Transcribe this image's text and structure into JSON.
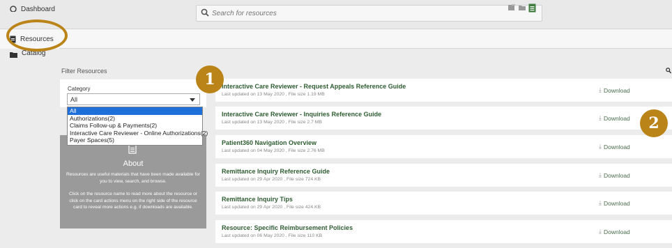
{
  "search": {
    "placeholder": "Search for resources"
  },
  "sidebar": {
    "items": [
      {
        "label": "Dashboard",
        "icon": "dashboard-icon"
      },
      {
        "label": "Resources",
        "icon": "document-icon"
      },
      {
        "label": "Catalog",
        "icon": "folder-icon"
      }
    ]
  },
  "filter": {
    "title": "Filter Resources",
    "category_label": "Category",
    "selected": "All",
    "options": [
      "All",
      "Authorizations(2)",
      "Claims Follow-up & Payments(2)",
      "Interactive Care Reviewer - Online Authorizations(2)",
      "Payer Spaces(5)"
    ]
  },
  "about": {
    "title": "About",
    "p1": "Resources are useful materials that have been made available for you to view, search, and browse.",
    "p2": "Click on the resource name to read more about the resource or click on the card actions menu on the right side of the resource card to reveal more actions e.g. if downloads are available."
  },
  "resources": [
    {
      "title": "Interactive Care Reviewer - Request Appeals Reference Guide",
      "meta": "Last updated on 13 May 2020 , File size 1.19 MB",
      "action": "Download"
    },
    {
      "title": "Interactive Care Reviewer - Inquiries Reference Guide",
      "meta": "Last updated on 13 May 2020 , File size 2.7 MB",
      "action": "Download"
    },
    {
      "title": "Patient360 Navigation Overview",
      "meta": "Last updated on 04 May 2020 , File size 2.76 MB",
      "action": "Download"
    },
    {
      "title": "Remittance Inquiry Reference Guide",
      "meta": "Last updated on 29 Apr 2020 , File size 724 KB",
      "action": "Download"
    },
    {
      "title": "Remittance Inquiry Tips",
      "meta": "Last updated on 29 Apr 2020 , File size 424 KB",
      "action": "Download"
    },
    {
      "title": "Resource: Specific Reimbursement Policies",
      "meta": "Last updated on 06 May 2020 , File size 110 KB",
      "action": "Download"
    }
  ],
  "annotations": {
    "badge1": "1",
    "badge2": "2",
    "color": "#bb8419"
  },
  "colors": {
    "title_green": "#2f5d32",
    "about_bg": "#9a9a9a",
    "select_highlight": "#1e6fd9"
  }
}
